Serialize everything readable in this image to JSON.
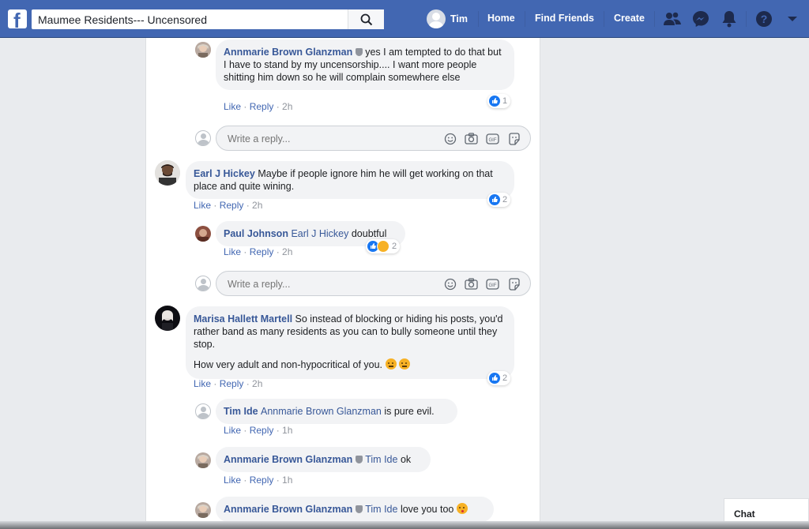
{
  "topbar": {
    "logo": "f",
    "search_value": "Maumee Residents--- Uncensored",
    "user_name": "Tim",
    "nav": [
      "Home",
      "Find Friends",
      "Create"
    ],
    "icons": [
      "friends-icon",
      "messenger-icon",
      "notifications-icon",
      "help-icon",
      "account-menu-icon"
    ],
    "brand_color": "#4267b2"
  },
  "reply_placeholder": "Write a reply...",
  "actions": {
    "like": "Like",
    "reply": "Reply",
    "sep": " · "
  },
  "comments": [
    {
      "author": "Annmarie Brown Glanzman",
      "text": "yes I am tempted to do that but I have to stand by my uncensorship.... I want more people shitting him down so he will complain somewhere else",
      "time": "2h",
      "reactions": "1"
    },
    {
      "author": "Earl J Hickey",
      "text": "Maybe if people ignore him he will get working on that place and quite wining.",
      "time": "2h",
      "reactions": "2"
    },
    {
      "author": "Paul Johnson",
      "tag": "Earl J Hickey",
      "text": "doubtful",
      "time": "2h",
      "reactions": "2"
    },
    {
      "author": "Marisa Hallett Martell",
      "text": "So instead of blocking or hiding his posts, you'd rather band as many residents as you can to bully someone until they stop.",
      "text2": "How very adult and non-hypocritical of you.",
      "time": "2h",
      "reactions": "2"
    },
    {
      "author": "Tim Ide",
      "tag": "Annmarie Brown Glanzman",
      "text": "is pure evil.",
      "time": "1h"
    },
    {
      "author": "Annmarie Brown Glanzman",
      "tag": "Tim Ide",
      "text": "ok",
      "time": "1h"
    },
    {
      "author": "Annmarie Brown Glanzman",
      "tag": "Tim Ide",
      "text": "love you too"
    }
  ],
  "chat": {
    "label": "Chat"
  }
}
